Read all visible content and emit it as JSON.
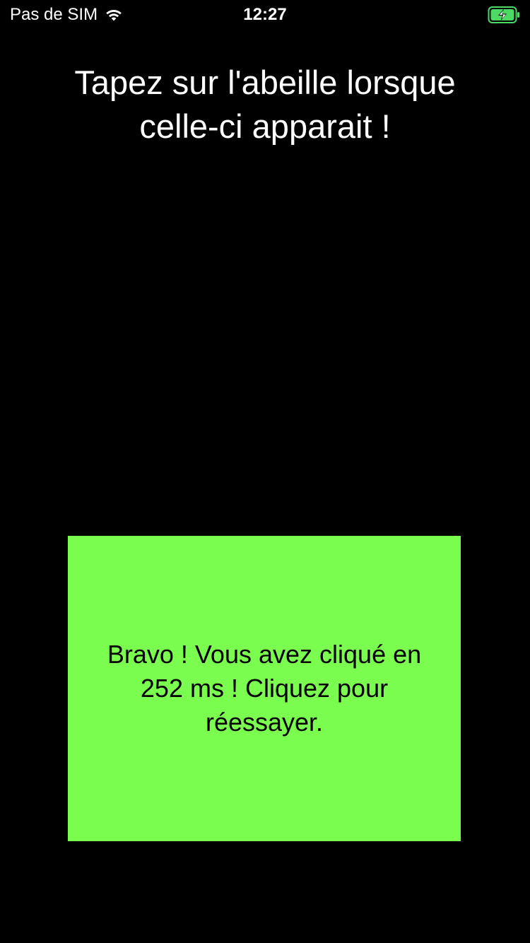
{
  "status_bar": {
    "carrier": "Pas de SIM",
    "time": "12:27",
    "wifi_icon": "wifi-icon",
    "battery_icon": "battery-charging-icon",
    "battery_color": "#4cd964"
  },
  "instruction": {
    "line1": "Tapez sur l'abeille lorsque",
    "line2": "celle-ci apparait !"
  },
  "result_panel": {
    "text": "Bravo ! Vous avez cliqué en 252 ms ! Cliquez pour réessayer.",
    "background": "#7bfd4f"
  }
}
